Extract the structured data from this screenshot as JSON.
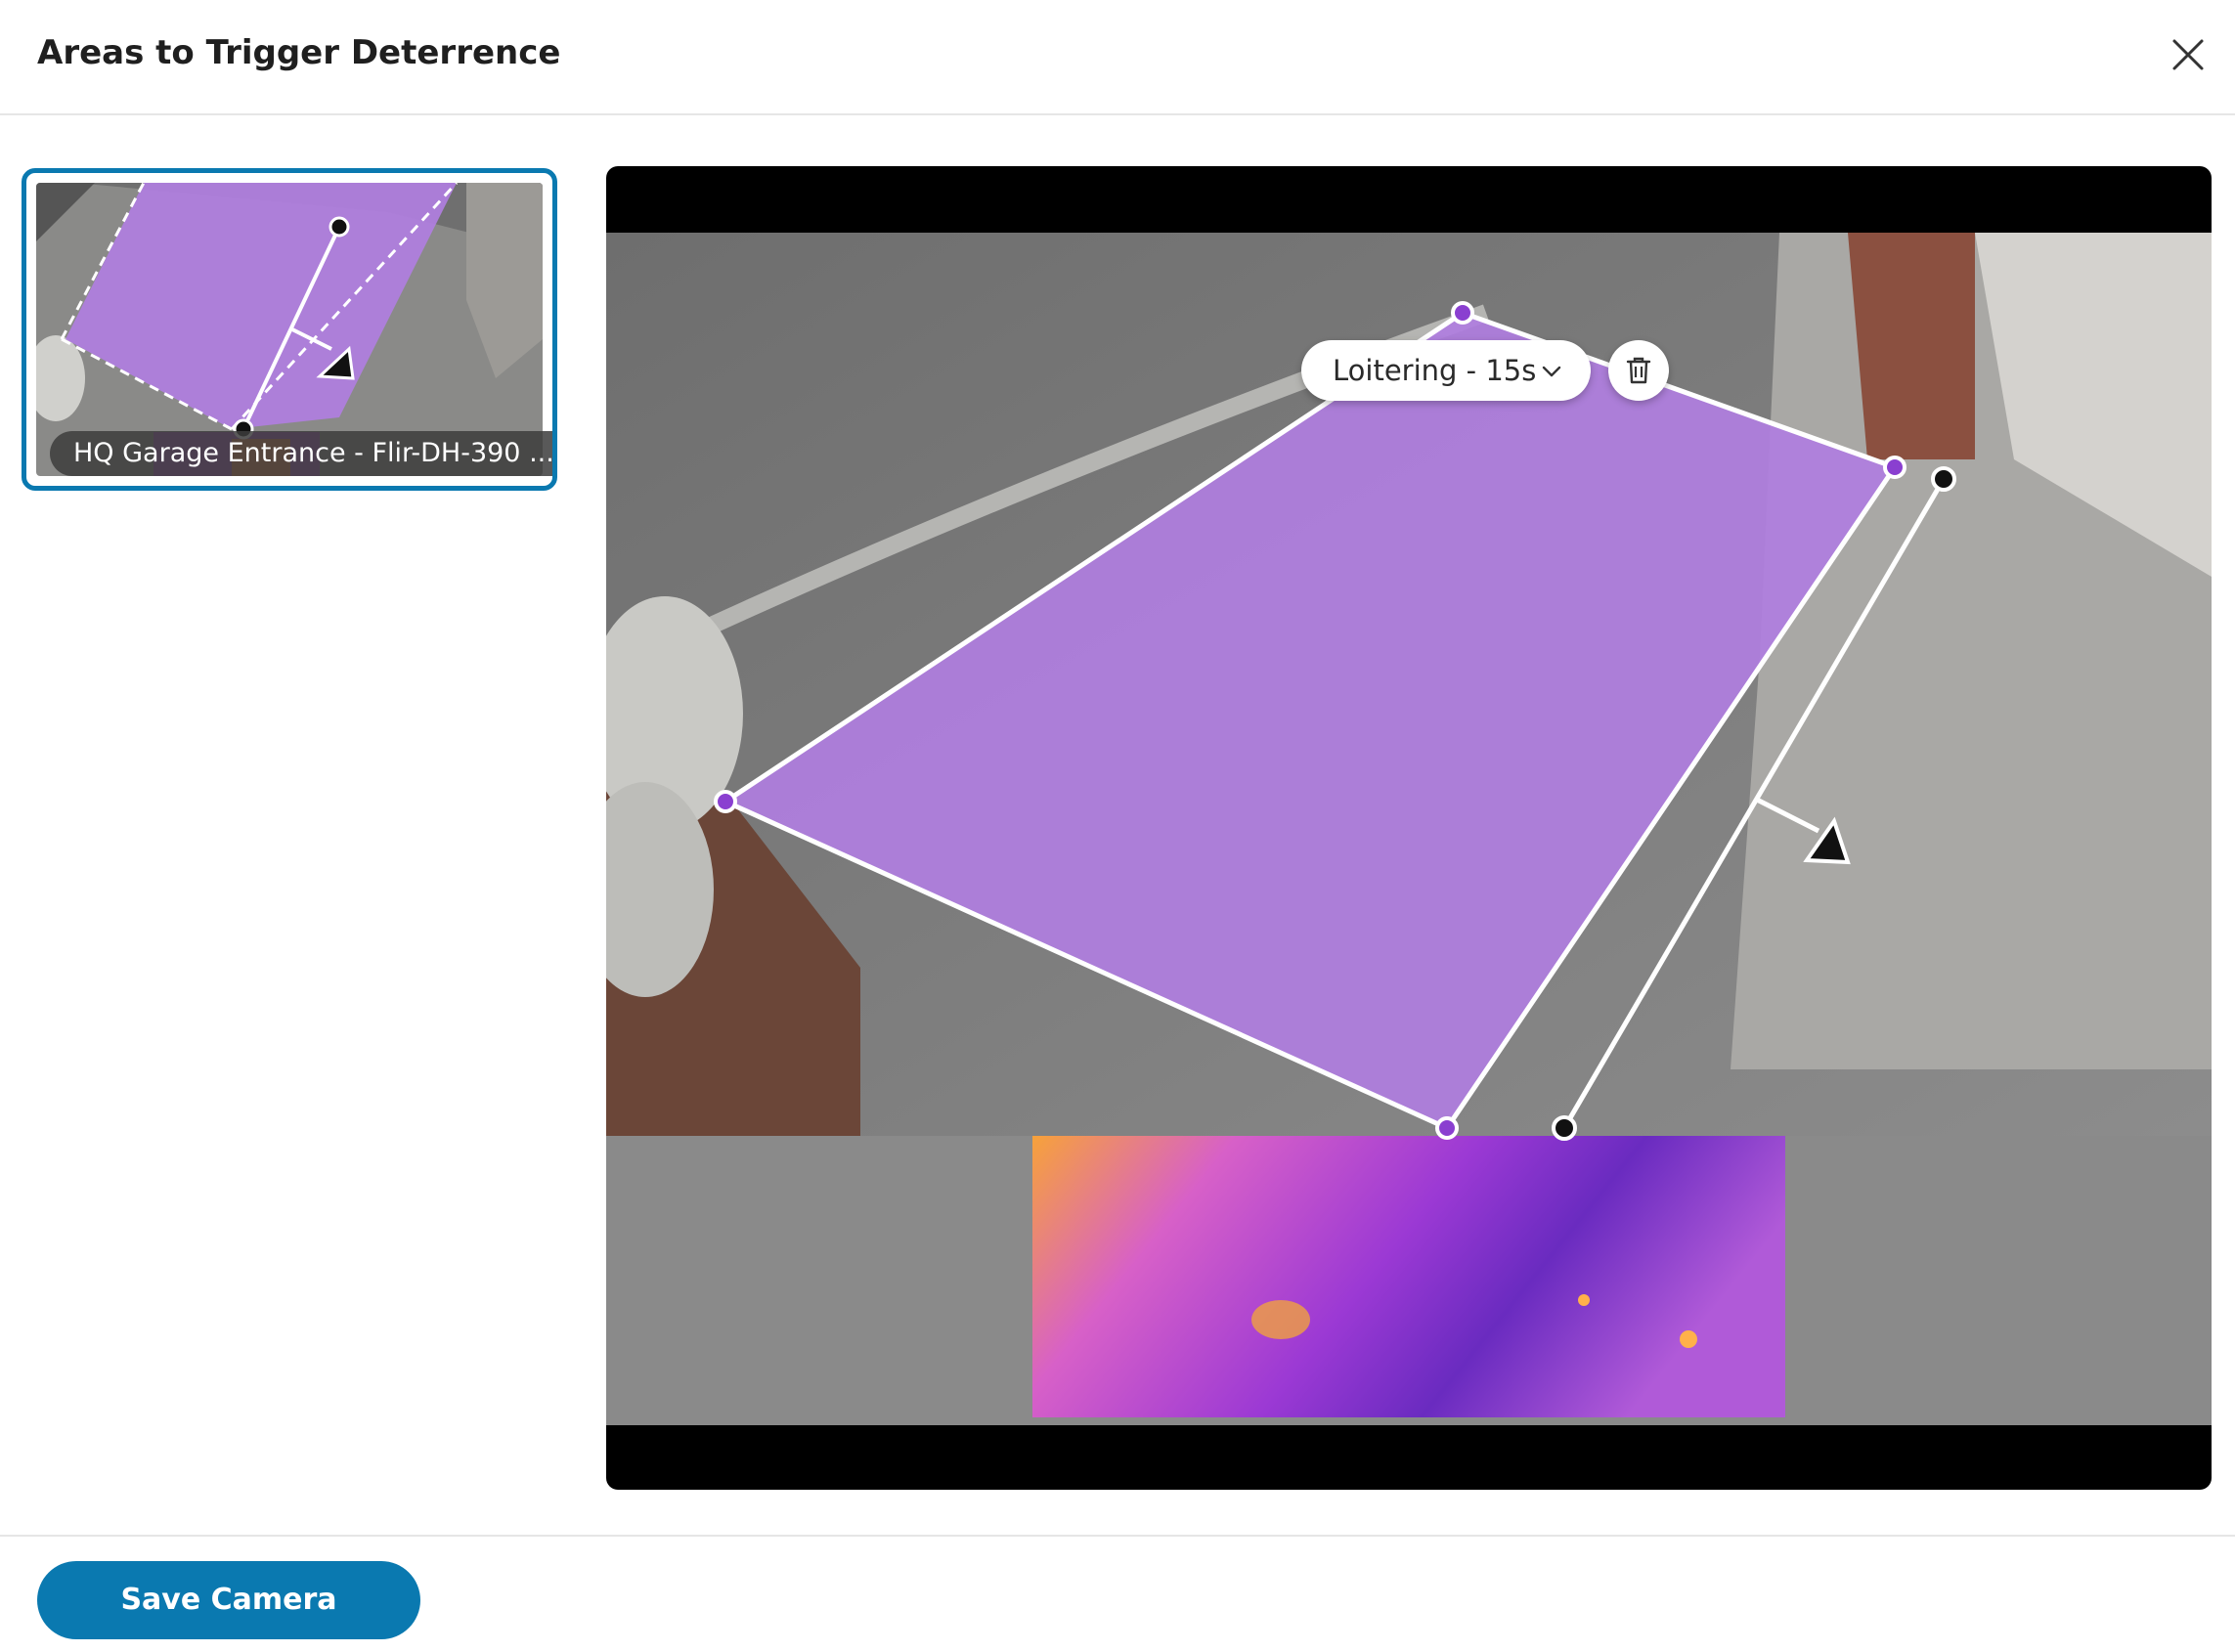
{
  "dialog": {
    "title": "Areas to Trigger Deterrence",
    "close_icon": "close-icon"
  },
  "camera_list": {
    "items": [
      {
        "label": "HQ Garage Entrance - Flir-DH-390 ...",
        "selected": true
      }
    ]
  },
  "zone": {
    "behavior_label": "Loitering - 15s",
    "dropdown_icon": "chevron-down-icon",
    "delete_icon": "trash-icon"
  },
  "colors": {
    "accent": "#0a79b0",
    "zone_fill": "#b07ee0",
    "zone_point": "#8a3fd0"
  },
  "footer": {
    "save_label": "Save Camera"
  }
}
